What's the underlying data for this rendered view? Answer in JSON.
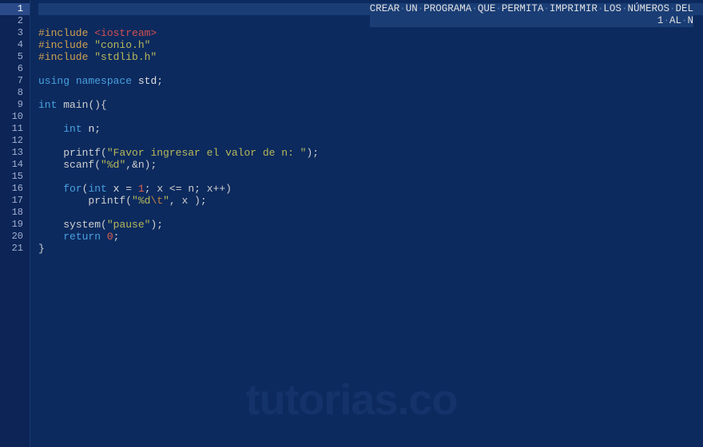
{
  "title_line1_parts": [
    "CREAR",
    "UN",
    "PROGRAMA",
    "QUE",
    "PERMITA",
    "IMPRIMIR",
    "LOS",
    "NÚMEROS",
    "DEL"
  ],
  "title_line2_parts": [
    "1",
    "AL",
    "N"
  ],
  "watermark": "tutorias.co",
  "line_numbers": [
    "1",
    "2",
    "3",
    "4",
    "5",
    "6",
    "7",
    "8",
    "9",
    "10",
    "11",
    "12",
    "13",
    "14",
    "15",
    "16",
    "17",
    "18",
    "19",
    "20",
    "21"
  ],
  "current_line": 1,
  "code": {
    "l3_pp": "#include ",
    "l3_inc": "<iostream>",
    "l4_pp": "#include ",
    "l4_inc": "\"conio.h\"",
    "l5_pp": "#include ",
    "l5_inc": "\"stdlib.h\"",
    "l7_using": "using",
    "l7_ns": "namespace",
    "l7_std": "std",
    "l9_int": "int",
    "l9_main": "main",
    "l11_int": "int",
    "l11_n": "n",
    "l13_printf": "printf",
    "l13_str": "\"Favor ingresar el valor de n: \"",
    "l14_scanf": "scanf",
    "l14_fmt": "\"%d\"",
    "l14_arg": ",&n",
    "l16_for": "for",
    "l16_int": "int",
    "l16_x": "x",
    "l16_one": "1",
    "l16_cond": "; x <= n; x++",
    "l17_printf": "printf",
    "l17_str_open": "\"%d",
    "l17_esc": "\\t",
    "l17_str_close": "\"",
    "l17_arg": ", x ",
    "l19_system": "system",
    "l19_str": "\"pause\"",
    "l20_return": "return",
    "l20_zero": "0"
  }
}
